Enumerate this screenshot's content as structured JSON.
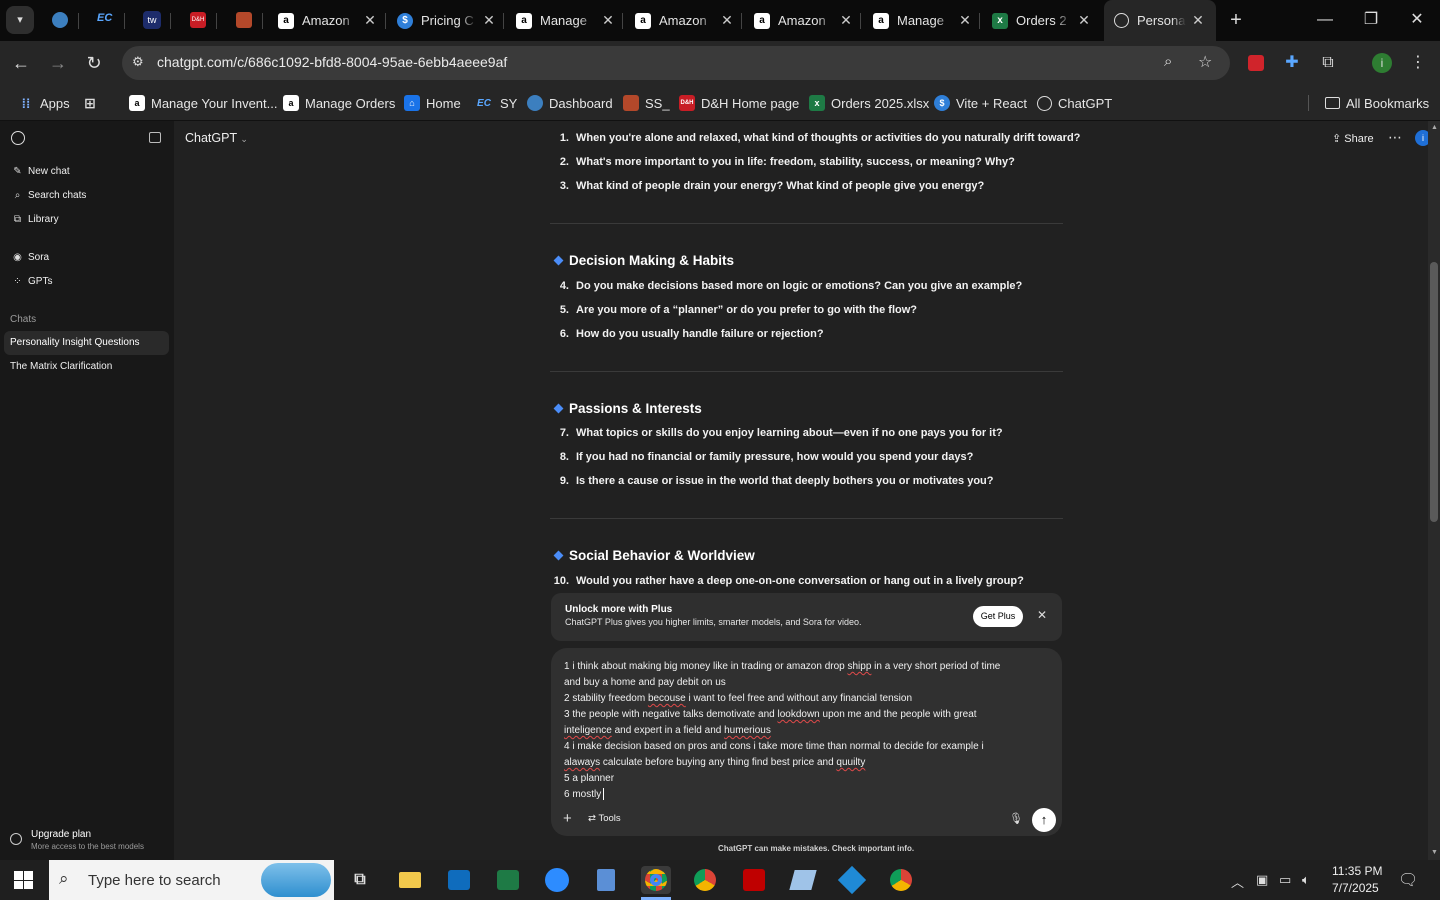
{
  "tabs": [
    {
      "title": "Amazon",
      "icon": "amazon-icon"
    },
    {
      "title": "Pricing C",
      "icon": "dollar-icon"
    },
    {
      "title": "Manage",
      "icon": "amazon-icon"
    },
    {
      "title": "Amazon",
      "icon": "amazon-icon"
    },
    {
      "title": "Amazon",
      "icon": "amazon-icon"
    },
    {
      "title": "Manage",
      "icon": "amazon-icon"
    },
    {
      "title": "Orders 2",
      "icon": "excel-icon"
    },
    {
      "title": "Personali",
      "icon": "openai-icon"
    }
  ],
  "pinned_tab_labels": {
    "ec": "EC",
    "tw": "tw",
    "dh": "D&H"
  },
  "address": {
    "url": "chatgpt.com/c/686c1092-bfd8-8004-95ae-6ebb4aeee9af"
  },
  "profile_initial": "i",
  "bookmarks": {
    "apps": "Apps",
    "items": [
      {
        "label": "Manage Your Invent...",
        "icon": "amazon-icon"
      },
      {
        "label": "Manage Orders",
        "icon": "amazon-icon"
      },
      {
        "label": "Home",
        "icon": "home-page-icon"
      },
      {
        "label": "SY",
        "icon": "ec-icon"
      },
      {
        "label": "Dashboard",
        "icon": "dashboard-icon"
      },
      {
        "label": "SS_",
        "icon": "ss-icon"
      },
      {
        "label": "D&H Home page",
        "icon": "dh-icon"
      },
      {
        "label": "Orders 2025.xlsx",
        "icon": "excel-icon"
      },
      {
        "label": "Vite + React",
        "icon": "dollar-icon"
      },
      {
        "label": "ChatGPT",
        "icon": "openai-icon"
      }
    ],
    "all": "All Bookmarks",
    "ec_label": "EC",
    "dh_label": "D&H"
  },
  "sidebar": {
    "new_chat": "New chat",
    "search_chats": "Search chats",
    "library": "Library",
    "sora": "Sora",
    "gpts": "GPTs",
    "chats_heading": "Chats",
    "chats": [
      "Personality Insight Questions",
      "The Matrix Clarification"
    ],
    "upgrade_title": "Upgrade plan",
    "upgrade_sub": "More access to the best models"
  },
  "header": {
    "model": "ChatGPT",
    "share": "Share",
    "avatar_initial": "i"
  },
  "content": {
    "q1": {
      "num": "1.",
      "text": "When you're alone and relaxed, what kind of thoughts or activities do you naturally drift toward?"
    },
    "q2": {
      "num": "2.",
      "text": "What's more important to you in life: freedom, stability, success, or meaning? Why?"
    },
    "q3": {
      "num": "3.",
      "text": "What kind of people drain your energy? What kind of people give you energy?"
    },
    "s1": "Decision Making & Habits",
    "q4": {
      "num": "4.",
      "text": "Do you make decisions based more on logic or emotions? Can you give an example?"
    },
    "q5": {
      "num": "5.",
      "text": "Are you more of a “planner” or do you prefer to go with the flow?"
    },
    "q6": {
      "num": "6.",
      "text": "How do you usually handle failure or rejection?"
    },
    "s2": "Passions & Interests",
    "q7": {
      "num": "7.",
      "text": "What topics or skills do you enjoy learning about—even if no one pays you for it?"
    },
    "q8": {
      "num": "8.",
      "text": "If you had no financial or family pressure, how would you spend your days?"
    },
    "q9": {
      "num": "9.",
      "text": "Is there a cause or issue in the world that deeply bothers you or motivates you?"
    },
    "s3": "Social Behavior & Worldview",
    "q10": {
      "num": "10.",
      "text": "Would you rather have a deep one-on-one conversation or hang out in a lively group?"
    }
  },
  "banner": {
    "title": "Unlock more with Plus",
    "text": "ChatGPT Plus gives you higher limits, smarter models, and Sora for video.",
    "button": "Get Plus"
  },
  "composer": {
    "l1a": "1 i think about making big money like in trading or amazon drop ",
    "l1b": "shipp",
    "l1c": "  in a very short period of time",
    "l2": "and buy a home and pay debit on us",
    "l3a": "2 stability freedom  ",
    "l3b": "becouse",
    "l3c": "  i want to  feel free and without any financial tension",
    "l4a": "3  the people with negative talks  demotivate and ",
    "l4b": "lookdown",
    "l4c": " upon me  and the people with great",
    "l5a": "inteligence",
    "l5b": " and expert in a field and ",
    "l5c": "humerious",
    "l6": "4   i make decision based on pros and cons i take more time than normal to decide  for example i",
    "l7a": "alaways",
    "l7b": " calculate before buying any thing find best price and ",
    "l7c": "quuilty",
    "l8": "5 a planner",
    "l9": "6  mostly",
    "tools": "Tools",
    "disclaimer": "ChatGPT can make mistakes. Check important info."
  },
  "taskbar": {
    "search_placeholder": "Type here to search",
    "time": "11:35 PM",
    "date": "7/7/2025"
  }
}
